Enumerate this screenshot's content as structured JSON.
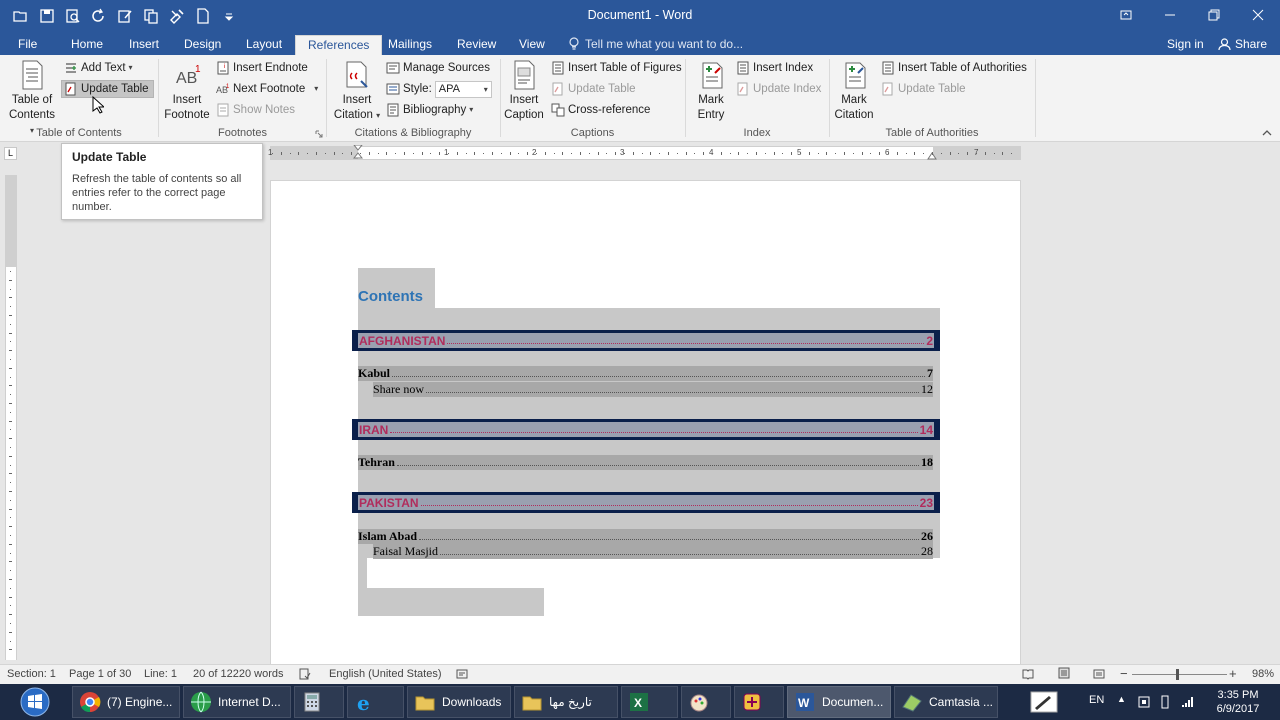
{
  "window": {
    "title": "Document1 - Word"
  },
  "tabs": [
    {
      "label": "File"
    },
    {
      "label": "Home"
    },
    {
      "label": "Insert"
    },
    {
      "label": "Design"
    },
    {
      "label": "Layout"
    },
    {
      "label": "References"
    },
    {
      "label": "Mailings"
    },
    {
      "label": "Review"
    },
    {
      "label": "View"
    }
  ],
  "tell_me": {
    "placeholder": "Tell me what you want to do..."
  },
  "account": {
    "sign_in": "Sign in",
    "share": "Share"
  },
  "ribbon": {
    "toc": {
      "table_of_contents": "Table of",
      "table_of_contents_2": "Contents",
      "add_text": "Add Text",
      "update_table": "Update Table",
      "group_label": "Table of Contents"
    },
    "footnotes": {
      "insert_footnote": "Insert",
      "insert_footnote_2": "Footnote",
      "insert_endnote": "Insert Endnote",
      "next_footnote": "Next Footnote",
      "show_notes": "Show Notes",
      "group_label": "Footnotes"
    },
    "citations": {
      "insert_citation": "Insert",
      "insert_citation_2": "Citation",
      "manage_sources": "Manage Sources",
      "style_label": "Style:",
      "style_value": "APA",
      "bibliography": "Bibliography",
      "group_label": "Citations & Bibliography"
    },
    "captions": {
      "insert_caption": "Insert",
      "insert_caption_2": "Caption",
      "insert_table_of_figures": "Insert Table of Figures",
      "update_table": "Update Table",
      "cross_reference": "Cross-reference",
      "group_label": "Captions"
    },
    "index": {
      "mark_entry": "Mark",
      "mark_entry_2": "Entry",
      "insert_index": "Insert Index",
      "update_index": "Update Index",
      "group_label": "Index"
    },
    "authorities": {
      "mark_citation": "Mark",
      "mark_citation_2": "Citation",
      "insert_table_of_authorities": "Insert Table of Authorities",
      "update_table": "Update Table",
      "group_label": "Table of Authorities"
    }
  },
  "ruler_numbers": [
    "1",
    "1",
    "2",
    "3",
    "4",
    "5",
    "6",
    "7"
  ],
  "tooltip": {
    "title": "Update Table",
    "body": "Refresh the table of contents so all entries refer to the correct page number."
  },
  "document": {
    "toc_title": "Contents",
    "entries": [
      {
        "level": 1,
        "text": "AFGHANISTAN",
        "page": "2"
      },
      {
        "level": 2,
        "text": "Kabul",
        "page": "7"
      },
      {
        "level": 3,
        "text": "Share now",
        "page": "12"
      },
      {
        "level": 1,
        "text": "IRAN",
        "page": "14"
      },
      {
        "level": 2,
        "text": "Tehran",
        "page": "18"
      },
      {
        "level": 1,
        "text": "PAKISTAN",
        "page": "23"
      },
      {
        "level": 2,
        "text": "Islam Abad",
        "page": "26"
      },
      {
        "level": 3,
        "text": "Faisal Masjid",
        "page": "28"
      }
    ]
  },
  "status": {
    "section": "Section: 1",
    "page": "Page 1 of 30",
    "line": "Line: 1",
    "words": "20 of 12220 words",
    "language": "English (United States)",
    "zoom": "98%"
  },
  "taskbar": {
    "items": [
      {
        "label": "(7) Engine..."
      },
      {
        "label": "Internet D..."
      },
      {
        "label": ""
      },
      {
        "label": ""
      },
      {
        "label": "Downloads"
      },
      {
        "label": "تاریخ مها"
      },
      {
        "label": ""
      },
      {
        "label": ""
      },
      {
        "label": ""
      },
      {
        "label": "Documen..."
      },
      {
        "label": "Camtasia ..."
      }
    ],
    "lang": "EN",
    "time": "3:35 PM",
    "date": "6/9/2017"
  },
  "colors": {
    "brand": "#2b579a",
    "toc_title": "#2e74b5",
    "heading1_text": "#b12c5c",
    "heading1_bg": "#0a1f4a",
    "field_shading": "#c8c8c8"
  }
}
